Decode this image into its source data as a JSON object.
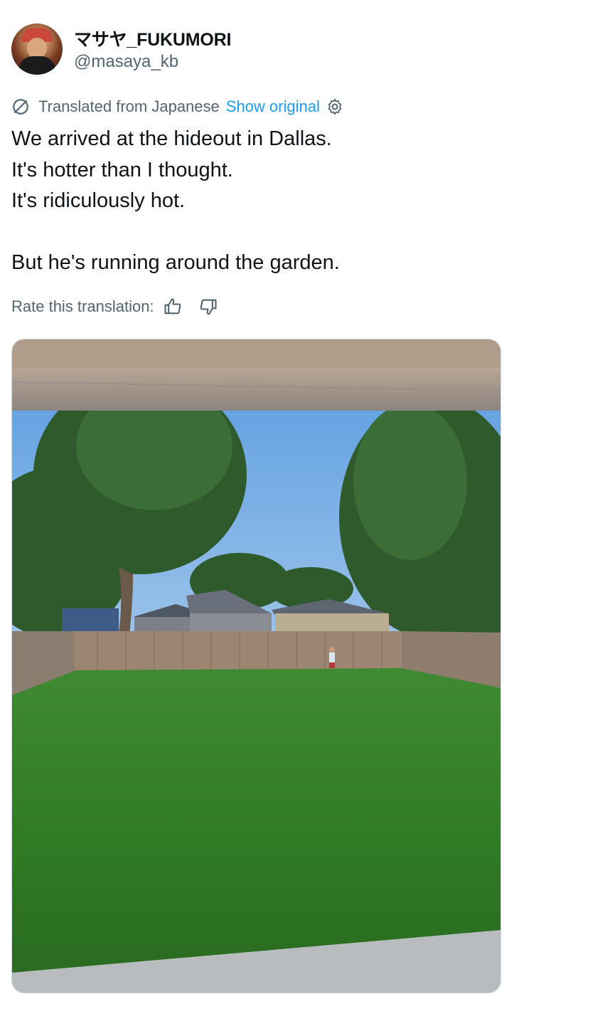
{
  "author": {
    "display_name": "マサヤ_FUKUMORI",
    "handle": "@masaya_kb",
    "avatar_icon": "profile-avatar"
  },
  "translation": {
    "label": "Translated from Japanese",
    "show_original": "Show original",
    "icon": "translate-globe-icon",
    "settings_icon": "gear-icon"
  },
  "tweet": {
    "lines": [
      "We arrived at the hideout in Dallas.",
      "It's hotter than I thought.",
      "It's ridiculously hot.",
      "",
      "But he's running around the garden."
    ]
  },
  "rate": {
    "label": "Rate this translation:",
    "up_icon": "thumbs-up-icon",
    "down_icon": "thumbs-down-icon"
  },
  "media": {
    "type": "photo",
    "subject": "backyard-lawn-with-fence"
  },
  "colors": {
    "link": "#1d9bf0",
    "secondary_text": "#536471",
    "primary_text": "#0f1419"
  }
}
